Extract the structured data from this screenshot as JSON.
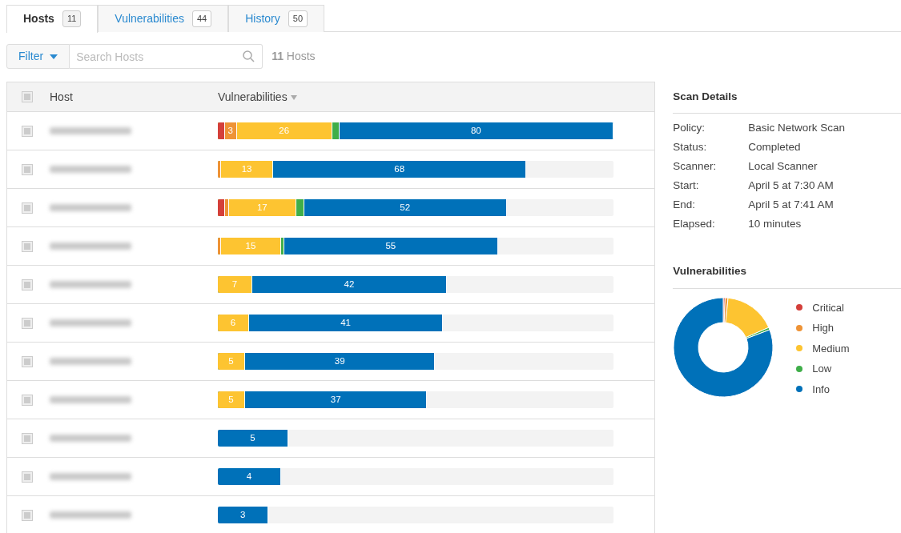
{
  "tabs": [
    {
      "label": "Hosts",
      "count": "11",
      "selected": true
    },
    {
      "label": "Vulnerabilities",
      "count": "44",
      "selected": false
    },
    {
      "label": "History",
      "count": "50",
      "selected": false
    }
  ],
  "filter": {
    "label": "Filter",
    "search_placeholder": "Search Hosts",
    "count": "11",
    "count_label": "Hosts"
  },
  "table": {
    "select_all": {
      "checked": false
    },
    "columns": [
      "Host",
      "Vulnerabilities"
    ],
    "rows": [
      {
        "checked": false,
        "segments": [
          {
            "kind": "critical",
            "level": 0.018
          },
          {
            "kind": "high",
            "level": 0.048,
            "label": "3"
          },
          {
            "kind": "medium",
            "level": 0.289,
            "label": "26"
          },
          {
            "kind": "low",
            "level": 0.307
          },
          {
            "kind": "info",
            "level": 1.0,
            "label": "80"
          }
        ]
      },
      {
        "checked": false,
        "segments": [
          {
            "kind": "high",
            "level": 0.008
          },
          {
            "kind": "medium",
            "level": 0.14,
            "label": "13"
          },
          {
            "kind": "info",
            "level": 0.78,
            "label": "68"
          }
        ]
      },
      {
        "checked": false,
        "segments": [
          {
            "kind": "critical",
            "level": 0.018
          },
          {
            "kind": "high",
            "level": 0.028
          },
          {
            "kind": "medium",
            "level": 0.198,
            "label": "17"
          },
          {
            "kind": "low",
            "level": 0.218
          },
          {
            "kind": "info",
            "level": 0.73,
            "label": "52"
          }
        ]
      },
      {
        "checked": false,
        "segments": [
          {
            "kind": "high",
            "level": 0.008
          },
          {
            "kind": "medium",
            "level": 0.16,
            "label": "15"
          },
          {
            "kind": "low",
            "level": 0.168
          },
          {
            "kind": "info",
            "level": 0.708,
            "label": "55"
          }
        ]
      },
      {
        "checked": false,
        "segments": [
          {
            "kind": "medium",
            "level": 0.087,
            "label": "7"
          },
          {
            "kind": "info",
            "level": 0.579,
            "label": "42"
          }
        ]
      },
      {
        "checked": false,
        "segments": [
          {
            "kind": "medium",
            "level": 0.079,
            "label": "6"
          },
          {
            "kind": "info",
            "level": 0.569,
            "label": "41"
          }
        ]
      },
      {
        "checked": false,
        "segments": [
          {
            "kind": "medium",
            "level": 0.069,
            "label": "5"
          },
          {
            "kind": "info",
            "level": 0.549,
            "label": "39"
          }
        ]
      },
      {
        "checked": false,
        "segments": [
          {
            "kind": "medium",
            "level": 0.069,
            "label": "5"
          },
          {
            "kind": "info",
            "level": 0.529,
            "label": "37"
          }
        ]
      },
      {
        "checked": false,
        "segments": [
          {
            "kind": "info",
            "level": 0.178,
            "label": "5"
          }
        ]
      },
      {
        "checked": false,
        "segments": [
          {
            "kind": "info",
            "level": 0.16,
            "label": "4"
          }
        ]
      },
      {
        "checked": false,
        "segments": [
          {
            "kind": "info",
            "level": 0.128,
            "label": "3"
          }
        ]
      }
    ]
  },
  "scan_details": {
    "title": "Scan Details",
    "fields": [
      {
        "label": "Policy:",
        "value": "Basic Network Scan"
      },
      {
        "label": "Status:",
        "value": "Completed"
      },
      {
        "label": "Scanner:",
        "value": "Local Scanner"
      },
      {
        "label": "Start:",
        "value": "April 5 at 7:30 AM"
      },
      {
        "label": "End:",
        "value": "April 5 at 7:41 AM"
      },
      {
        "label": "Elapsed:",
        "value": "10 minutes"
      }
    ]
  },
  "vulnerabilities": {
    "title": "Vulnerabilities",
    "legend": [
      {
        "kind": "critical",
        "label": "Critical",
        "color": "#d43f3a"
      },
      {
        "kind": "high",
        "label": "High",
        "color": "#ee9336"
      },
      {
        "kind": "medium",
        "label": "Medium",
        "color": "#fdc431"
      },
      {
        "kind": "low",
        "label": "Low",
        "color": "#3fae49"
      },
      {
        "kind": "info",
        "label": "Info",
        "color": "#0071b9"
      }
    ]
  }
}
